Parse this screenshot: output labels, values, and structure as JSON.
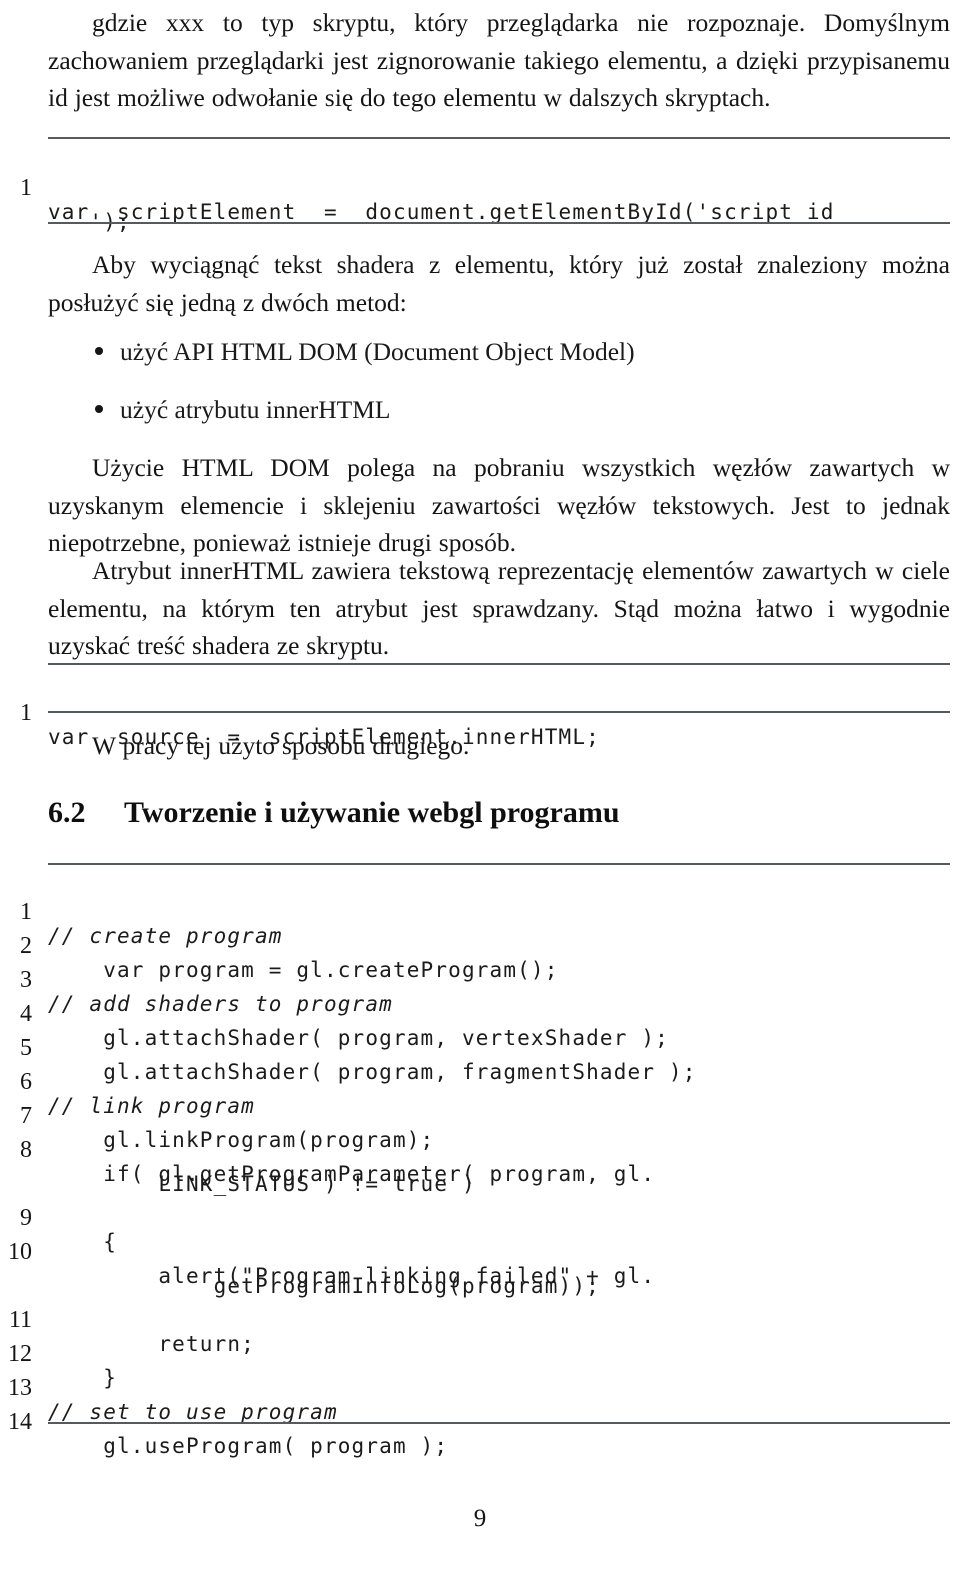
{
  "document": {
    "language": "pl",
    "page_number": "9",
    "paragraphs": {
      "p1": "gdzie xxx to typ skryptu, który przeglądarka nie rozpoznaje. Domyślnym zachowaniem przeglądarki jest zignorowanie takiego elementu, a dzięki przypisanemu id jest możliwe odwołanie się do tego elementu w dalszych skryptach.",
      "p2": "Aby wyciągnąć tekst shadera z elementu, który już został znaleziony można posłużyć się jedną z dwóch metod:",
      "p3": "Użycie HTML DOM polega na pobraniu wszystkich węzłów zawartych w uzyskanym elemencie i sklejeniu zawartości węzłów tekstowych. Jest to jednak niepotrzebne, ponieważ istnieje drugi sposób.",
      "p4": "Atrybut innerHTML zawiera tekstową reprezentację elementów zawartych w ciele elementu, na którym ten atrybut jest sprawdzany. Stąd można łatwo i wygodnie uzyskać treść shadera ze skryptu.",
      "p5": "W pracy tej użyto sposobu drugiego."
    },
    "bullets": [
      "użyć API HTML DOM (Document Object Model)",
      "użyć atrybutu innerHTML"
    ],
    "section": {
      "number": "6.2",
      "title": "Tworzenie i używanie webgl programu"
    },
    "listing1": {
      "lines": [
        {
          "no": "1",
          "code": "var  scriptElement  =  document.getElementById('script_id",
          "cont": "   ');"
        }
      ]
    },
    "listing2": {
      "lines": [
        {
          "no": "1",
          "code": "var  source  =  scriptElement.innerHTML;",
          "cont": ""
        }
      ]
    },
    "listing3": {
      "lines": [
        {
          "no": "1",
          "code": "// create program",
          "cont": "",
          "comment": true
        },
        {
          "no": "2",
          "code": "    var program = gl.createProgram();",
          "cont": "",
          "comment": false
        },
        {
          "no": "3",
          "code": "// add shaders to program",
          "cont": "",
          "comment": true
        },
        {
          "no": "4",
          "code": "    gl.attachShader( program, vertexShader );",
          "cont": "",
          "comment": false
        },
        {
          "no": "5",
          "code": "    gl.attachShader( program, fragmentShader );",
          "cont": "",
          "comment": false
        },
        {
          "no": "6",
          "code": "// link program",
          "cont": "",
          "comment": true
        },
        {
          "no": "7",
          "code": "    gl.linkProgram(program);",
          "cont": "",
          "comment": false
        },
        {
          "no": "8",
          "code": "    if( gl.getProgramParameter( program, gl.",
          "cont": "        LINK_STATUS ) != true )",
          "comment": false
        },
        {
          "no": "9",
          "code": "    {",
          "cont": "",
          "comment": false
        },
        {
          "no": "10",
          "code": "        alert(\"Program linking failed\" + gl.",
          "cont": "            getProgramInfoLog(program));",
          "comment": false
        },
        {
          "no": "11",
          "code": "        return;",
          "cont": "",
          "comment": false
        },
        {
          "no": "12",
          "code": "    }",
          "cont": "",
          "comment": false
        },
        {
          "no": "13",
          "code": "// set to use program",
          "cont": "",
          "comment": true
        },
        {
          "no": "14",
          "code": "    gl.useProgram( program );",
          "cont": "",
          "comment": false
        }
      ]
    }
  }
}
